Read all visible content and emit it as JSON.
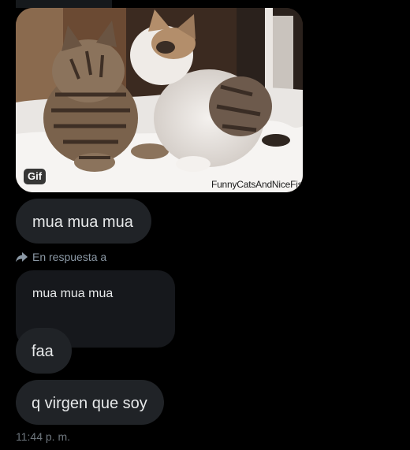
{
  "conversation": {
    "gif": {
      "badge": "Gif",
      "watermark": "FunnyCatsAndNiceFish"
    },
    "messages": [
      {
        "text": "mua mua mua"
      },
      {
        "text": "faa"
      },
      {
        "text": "q virgen que soy"
      }
    ],
    "reply": {
      "label": "En respuesta a",
      "quoted_text": "mua mua mua"
    },
    "timestamp": "11:44 p. m."
  },
  "colors": {
    "background": "#000000",
    "bubble": "#202327",
    "quoted_bubble": "#16181c",
    "text_primary": "#e7e9ea",
    "text_secondary": "#8b98a5"
  }
}
